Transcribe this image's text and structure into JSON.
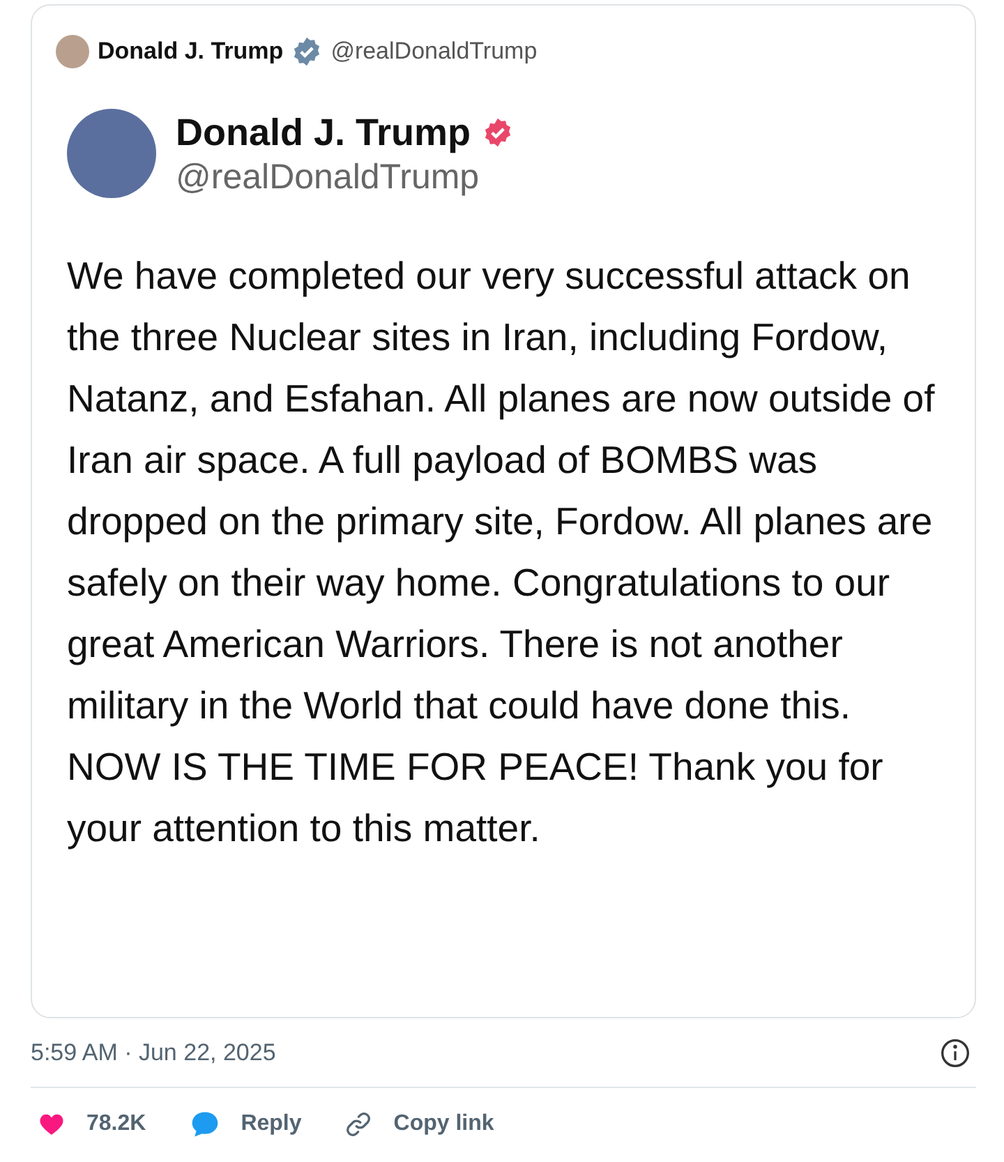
{
  "embed_header": {
    "name": "Donald J. Trump",
    "handle": "@realDonaldTrump",
    "verified": true
  },
  "post": {
    "name": "Donald J. Trump",
    "handle": "@realDonaldTrump",
    "verified": true,
    "text": "We have completed our very successful attack on the three Nuclear sites in Iran, including Fordow, Natanz, and Esfahan. All planes are now outside of Iran air space. A full payload of BOMBS was dropped on the primary site, Fordow. All planes are safely on their way home. Congratulations to our great American Warriors. There is not another military in the World that could have done this. NOW IS THE TIME FOR PEACE! Thank you for your attention to this matter."
  },
  "timestamp": "5:59 AM · Jun 22, 2025",
  "actions": [
    {
      "kind": "like",
      "label": "78.2K"
    },
    {
      "kind": "reply",
      "label": "Reply"
    },
    {
      "kind": "copy",
      "label": "Copy link"
    }
  ]
}
